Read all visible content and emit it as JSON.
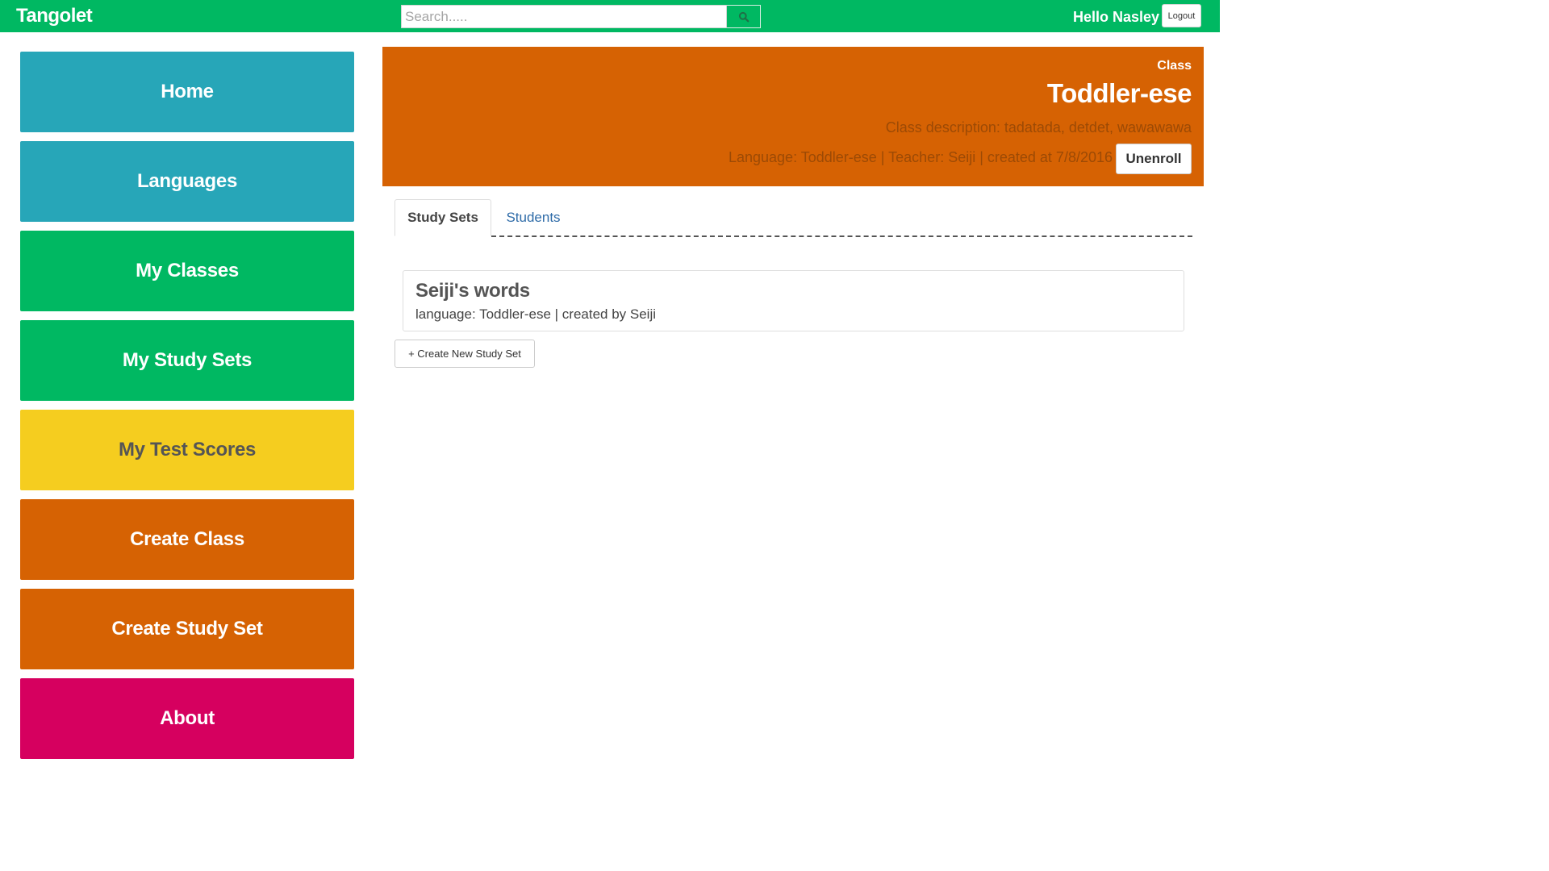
{
  "colors": {
    "navbar": "#00b862",
    "home": "#27a6b8",
    "languages": "#27a6b8",
    "my_classes": "#00b862",
    "my_study_sets": "#00b862",
    "my_test_scores": "#f5cd1f",
    "create_class": "#d66203",
    "create_study_set": "#d66203",
    "about": "#d6005f",
    "class_header": "#d66203"
  },
  "navbar": {
    "brand": "Tangolet",
    "search_placeholder": "Search.....",
    "search_icon": "search-icon",
    "greeting": "Hello Nasley",
    "logout_label": "Logout"
  },
  "sidebar": {
    "items": [
      {
        "label": "Home"
      },
      {
        "label": "Languages"
      },
      {
        "label": "My Classes"
      },
      {
        "label": "My Study Sets"
      },
      {
        "label": "My Test Scores"
      },
      {
        "label": "Create Class"
      },
      {
        "label": "Create Study Set"
      },
      {
        "label": "About"
      }
    ]
  },
  "class_header": {
    "kicker": "Class",
    "title": "Toddler-ese",
    "description": "Class description: tadatada, detdet, wawawawa",
    "meta": "Language: Toddler-ese | Teacher: Seiji | created at 7/8/2016",
    "unenroll_label": "Unenroll"
  },
  "tabs": [
    {
      "label": "Study Sets",
      "active": true
    },
    {
      "label": "Students",
      "active": false
    }
  ],
  "study_sets": [
    {
      "title": "Seiji's words",
      "meta": "language: Toddler-ese | created by Seiji"
    }
  ],
  "create_study_set_label": "+ Create New Study Set"
}
